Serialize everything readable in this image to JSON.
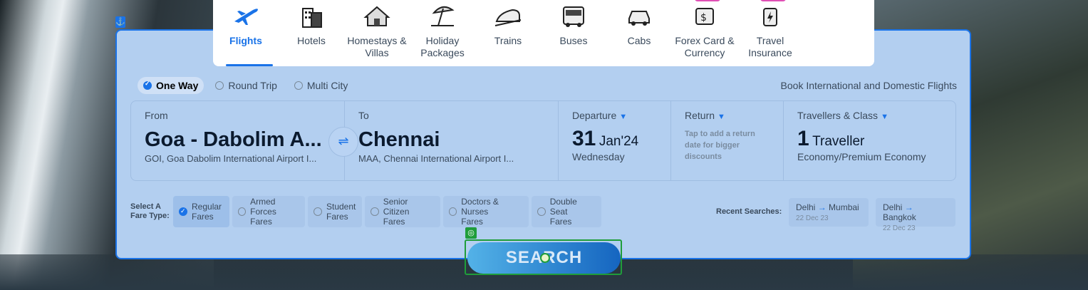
{
  "nav": [
    {
      "label": "Flights",
      "icon": "plane-icon",
      "active": true
    },
    {
      "label": "Hotels",
      "icon": "hotel-icon"
    },
    {
      "label": "Homestays & Villas",
      "icon": "homestay-icon"
    },
    {
      "label": "Holiday Packages",
      "icon": "beach-umbrella-icon"
    },
    {
      "label": "Trains",
      "icon": "train-icon"
    },
    {
      "label": "Buses",
      "icon": "bus-icon"
    },
    {
      "label": "Cabs",
      "icon": "cab-icon"
    },
    {
      "label": "Forex Card & Currency",
      "icon": "forex-icon"
    },
    {
      "label": "Travel Insurance",
      "icon": "insurance-icon"
    }
  ],
  "trip_types": [
    "One Way",
    "Round Trip",
    "Multi City"
  ],
  "book_text": "Book International and Domestic Flights",
  "from": {
    "caption": "From",
    "city": "Goa - Dabolim A...",
    "sub": "GOI, Goa Dabolim International Airport I..."
  },
  "to": {
    "caption": "To",
    "city": "Chennai",
    "sub": "MAA, Chennai International Airport I..."
  },
  "departure": {
    "caption": "Departure",
    "day": "31",
    "month": "Jan'24",
    "weekday": "Wednesday"
  },
  "return": {
    "caption": "Return",
    "hint": "Tap to add a return date for bigger discounts"
  },
  "travellers": {
    "caption": "Travellers & Class",
    "count": "1",
    "word": "Traveller",
    "class": "Economy/Premium Economy"
  },
  "fare_label": "Select A Fare Type:",
  "fares": [
    {
      "l1": "Regular",
      "l2": "Fares"
    },
    {
      "l1": "Armed Forces",
      "l2": "Fares"
    },
    {
      "l1": "Student",
      "l2": "Fares"
    },
    {
      "l1": "Senior Citizen",
      "l2": "Fares"
    },
    {
      "l1": "Doctors & Nurses",
      "l2": "Fares"
    },
    {
      "l1": "Double Seat",
      "l2": "Fares"
    }
  ],
  "recent_label": "Recent Searches:",
  "recent": [
    {
      "from": "Delhi",
      "to": "Mumbai",
      "date": "22 Dec 23"
    },
    {
      "from": "Delhi",
      "to": "Bangkok",
      "date": "22 Dec 23"
    }
  ],
  "search_label": "SEARCH"
}
